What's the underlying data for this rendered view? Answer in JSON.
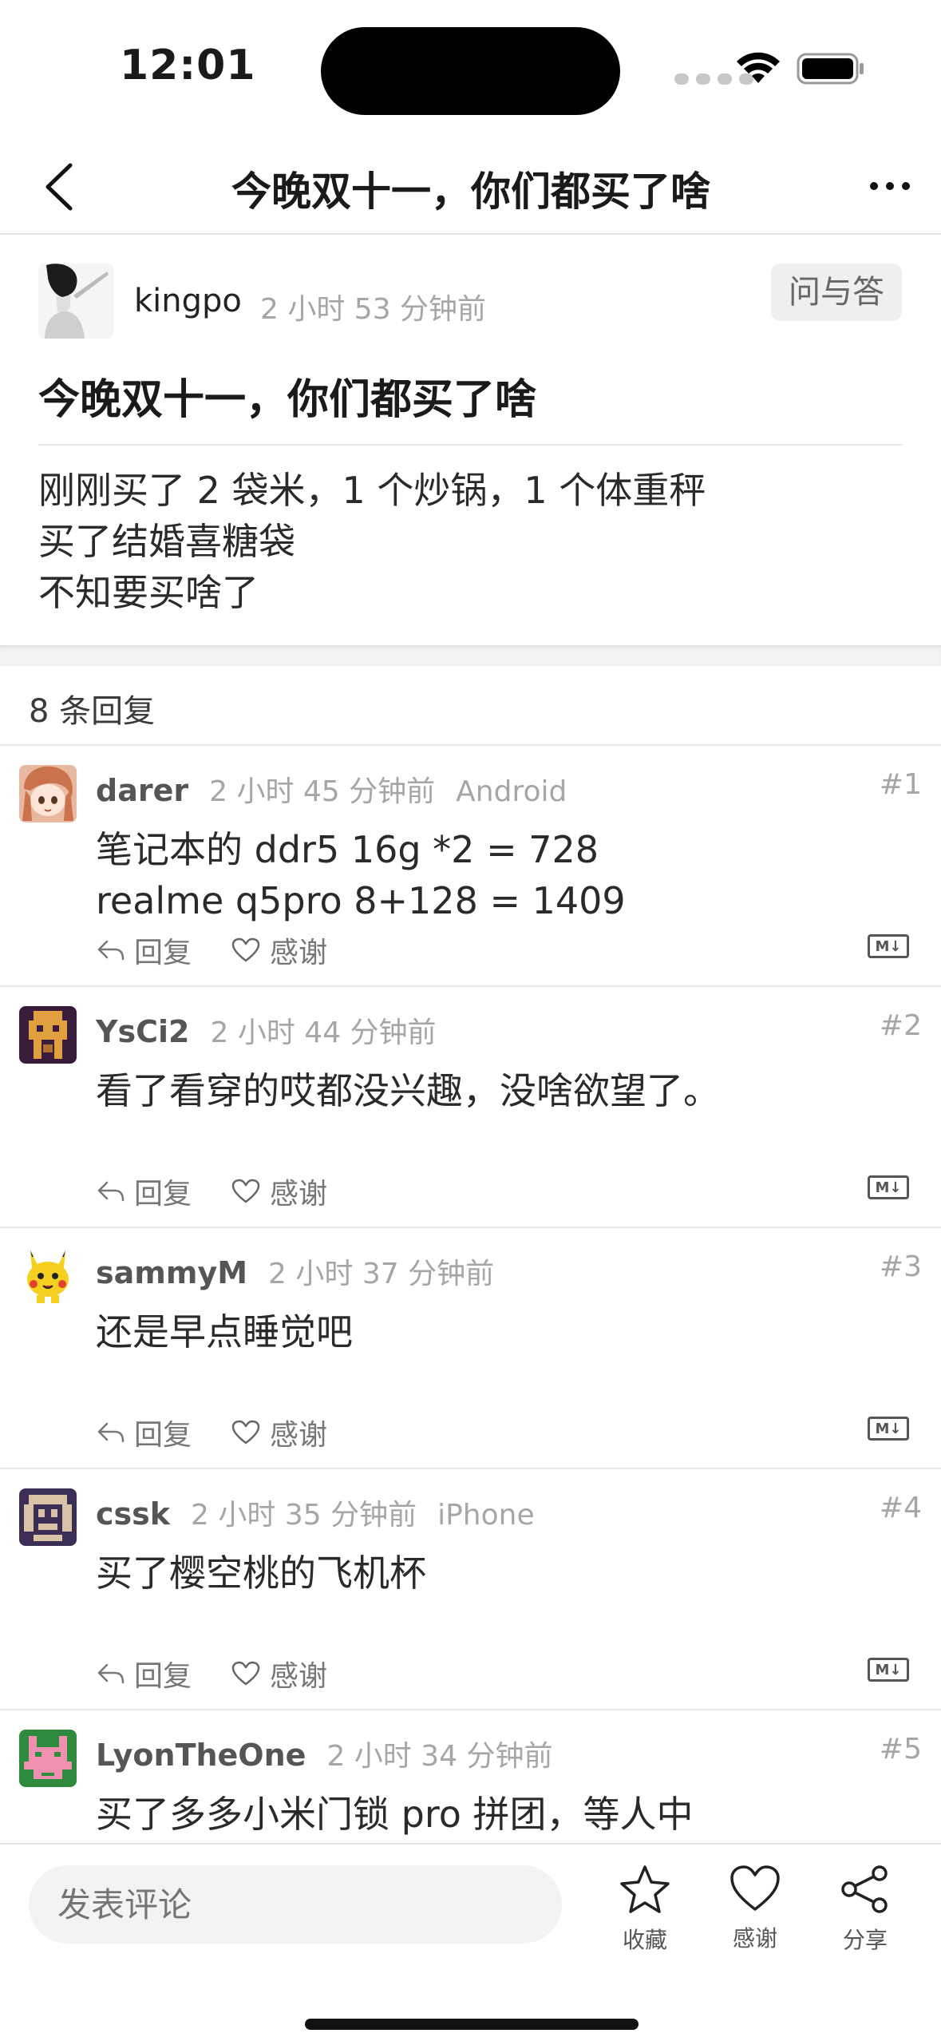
{
  "status_bar": {
    "time": "12:01"
  },
  "nav": {
    "title": "今晚双十一，你们都买了啥",
    "back_icon": "chevron-left-icon",
    "more_icon": "ellipsis-icon"
  },
  "topic": {
    "author": "kingpo",
    "time": "2 小时 53 分钟前",
    "badge": "问与答",
    "title": "今晚双十一，你们都买了啥",
    "body": [
      "刚刚买了 2 袋米，1 个炒锅，1 个体重秤",
      "买了结婚喜糖袋",
      "不知要买啥了"
    ]
  },
  "reply_count": "8 条回复",
  "reply_actions": {
    "reply_label": "回复",
    "thanks_label": "感谢",
    "markdown_badge": "M↓"
  },
  "replies": [
    {
      "name": "darer",
      "time": "2 小时 45 分钟前",
      "device": "Android",
      "floor": "#1",
      "body": [
        "笔记本的 ddr5 16g *2 = 728",
        "realme q5pro 8+128 = 1409"
      ]
    },
    {
      "name": "YsCi2",
      "time": "2 小时 44 分钟前",
      "device": "",
      "floor": "#2",
      "body": [
        "看了看穿的哎都没兴趣，没啥欲望了。"
      ]
    },
    {
      "name": "sammyM",
      "time": "2 小时 37 分钟前",
      "device": "",
      "floor": "#3",
      "body": [
        "还是早点睡觉吧"
      ]
    },
    {
      "name": "cssk",
      "time": "2 小时 35 分钟前",
      "device": "iPhone",
      "floor": "#4",
      "body": [
        "买了樱空桃的飞机杯"
      ]
    },
    {
      "name": "LyonTheOne",
      "time": "2 小时 34 分钟前",
      "device": "",
      "floor": "#5",
      "body": [
        "买了多多小米门锁 pro 拼团，等人中"
      ]
    }
  ],
  "bottom_bar": {
    "comment_placeholder": "发表评论",
    "favorite_label": "收藏",
    "thanks_label": "感谢",
    "share_label": "分享"
  }
}
